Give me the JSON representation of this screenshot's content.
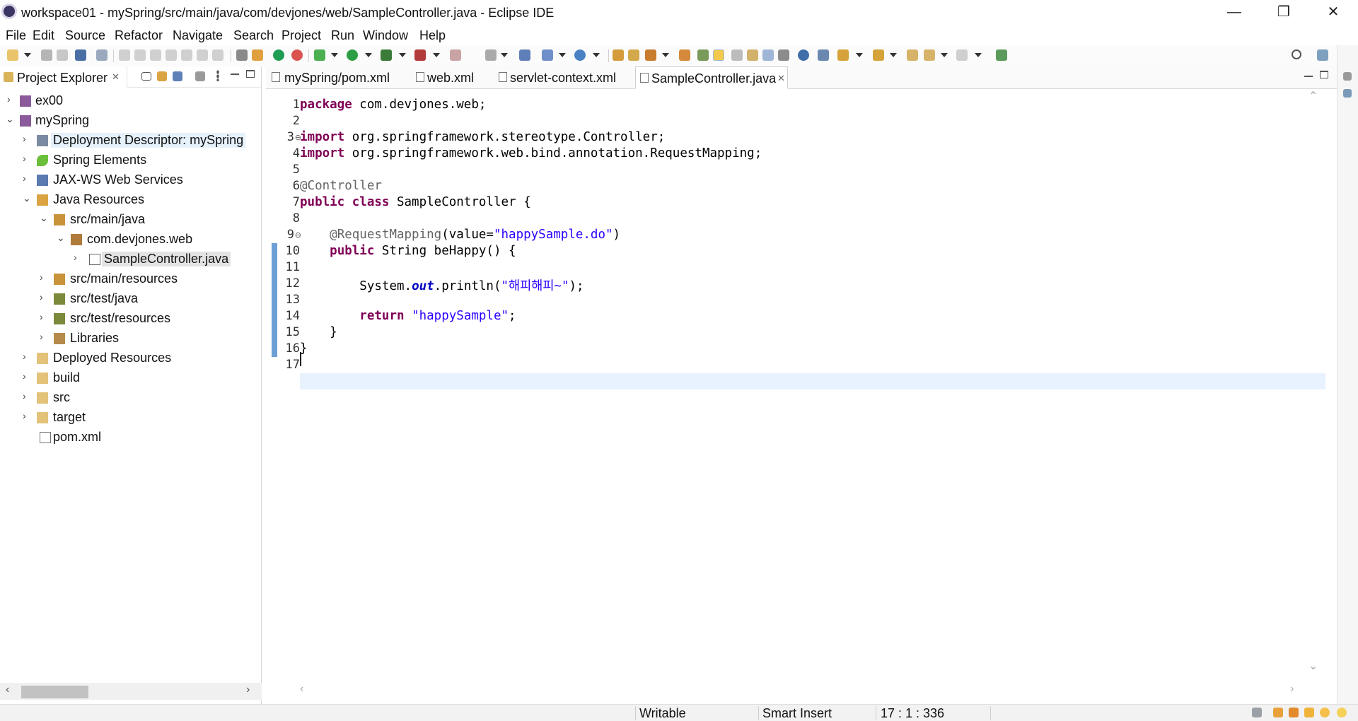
{
  "window": {
    "title": "workspace01 - mySpring/src/main/java/com/devjones/web/SampleController.java - Eclipse IDE",
    "minimize": "—",
    "restore": "❐",
    "close": "✕"
  },
  "menu": [
    "File",
    "Edit",
    "Source",
    "Refactor",
    "Navigate",
    "Search",
    "Project",
    "Run",
    "Window",
    "Help"
  ],
  "explorer": {
    "title": "Project Explorer",
    "close": "✕",
    "tree": [
      {
        "label": "ex00",
        "icon": "project-icon",
        "twisty": "›"
      },
      {
        "label": "mySpring",
        "icon": "project-icon",
        "twisty": "⌄"
      },
      {
        "label": "Deployment Descriptor: mySpring",
        "icon": "deployment-descriptor-icon",
        "twisty": "›"
      },
      {
        "label": "Spring Elements",
        "icon": "spring-leaf-icon",
        "twisty": "›"
      },
      {
        "label": "JAX-WS Web Services",
        "icon": "web-services-icon",
        "twisty": "›"
      },
      {
        "label": "Java Resources",
        "icon": "java-resources-icon",
        "twisty": "⌄"
      },
      {
        "label": "src/main/java",
        "icon": "source-folder-icon",
        "twisty": "⌄"
      },
      {
        "label": "com.devjones.web",
        "icon": "package-icon",
        "twisty": "⌄"
      },
      {
        "label": "SampleController.java",
        "icon": "java-file-icon",
        "twisty": "›"
      },
      {
        "label": "src/main/resources",
        "icon": "source-folder-icon",
        "twisty": "›"
      },
      {
        "label": "src/test/java",
        "icon": "source-folder-icon",
        "twisty": "›"
      },
      {
        "label": "src/test/resources",
        "icon": "source-folder-icon",
        "twisty": "›"
      },
      {
        "label": "Libraries",
        "icon": "libraries-icon",
        "twisty": "›"
      },
      {
        "label": "Deployed Resources",
        "icon": "folder-icon",
        "twisty": "›"
      },
      {
        "label": "build",
        "icon": "folder-icon",
        "twisty": "›"
      },
      {
        "label": "src",
        "icon": "folder-icon",
        "twisty": "›"
      },
      {
        "label": "target",
        "icon": "folder-icon",
        "twisty": "›"
      },
      {
        "label": "pom.xml",
        "icon": "xml-file-icon",
        "twisty": ""
      }
    ]
  },
  "editor": {
    "tabs": [
      {
        "label": "mySpring/pom.xml"
      },
      {
        "label": "web.xml"
      },
      {
        "label": "servlet-context.xml"
      },
      {
        "label": "SampleController.java",
        "active": true
      }
    ],
    "tab_close": "✕",
    "line_numbers": [
      "1",
      "2",
      "3",
      "4",
      "5",
      "6",
      "7",
      "8",
      "9",
      "10",
      "11",
      "12",
      "13",
      "14",
      "15",
      "16",
      "17"
    ],
    "code": {
      "l1_kw": "package",
      "l1_rest": " com.devjones.web;",
      "l3_kw": "import",
      "l3_rest": " org.springframework.stereotype.Controller;",
      "l4_kw": "import",
      "l4_rest": " org.springframework.web.bind.annotation.RequestMapping;",
      "l6_ann": "@Controller",
      "l7_kw1": "public",
      "l7_kw2": "class",
      "l7_rest": " SampleController {",
      "l9_ann": "@RequestMapping",
      "l9_mid": "(value=",
      "l9_str": "\"happySample.do\"",
      "l9_end": ")",
      "l10_kw": "public",
      "l10_rest": " String beHappy() {",
      "l12_pre": "System.",
      "l12_fld": "out",
      "l12_mid": ".println(",
      "l12_str": "\"해피해피~\"",
      "l12_end": ");",
      "l14_kw": "return",
      "l14_str": "\"happySample\"",
      "l14_end": ";",
      "l15": "}",
      "l16": "}"
    }
  },
  "status": {
    "writable": "Writable",
    "insert_mode": "Smart Insert",
    "position": "17 : 1 : 336"
  }
}
